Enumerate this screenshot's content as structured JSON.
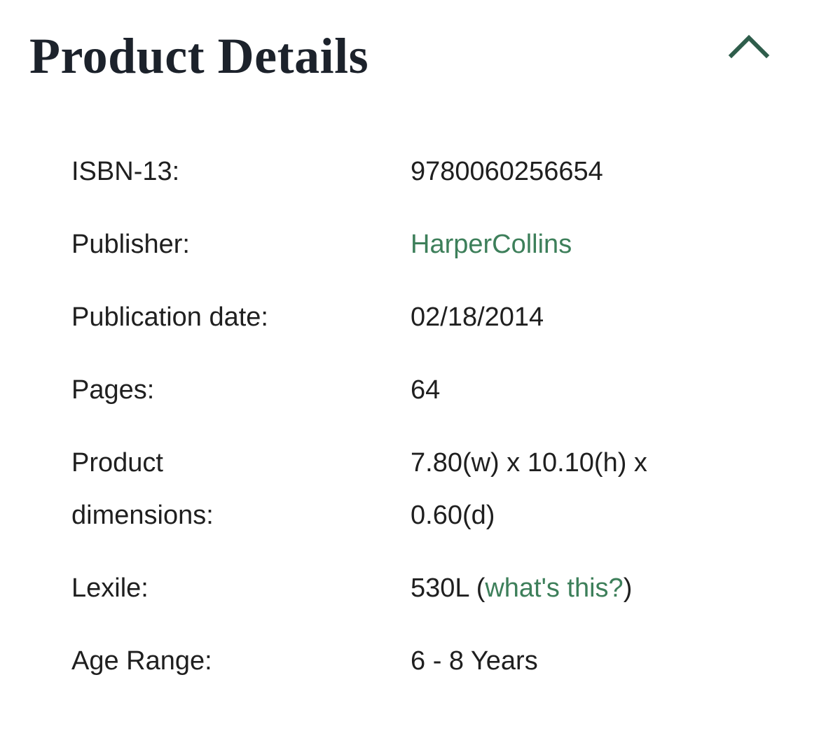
{
  "section": {
    "title": "Product Details",
    "toggle_icon": "chevron-up-icon",
    "accent_color": "#2e5d4b",
    "link_color": "#3d7f5a"
  },
  "details": {
    "isbn": {
      "label": "ISBN-13:",
      "value": "9780060256654"
    },
    "publisher": {
      "label": "Publisher:",
      "value": "HarperCollins"
    },
    "publication_date": {
      "label": "Publication date:",
      "value": "02/18/2014"
    },
    "pages": {
      "label": "Pages:",
      "value": "64"
    },
    "dimensions": {
      "label_line1": "Product",
      "label_line2": "dimensions:",
      "value_line1": "7.80(w) x 10.10(h) x",
      "value_line2": "0.60(d)"
    },
    "lexile": {
      "label": "Lexile:",
      "value": "530L",
      "open_paren": "(",
      "link": "what's this?",
      "close_paren": ")"
    },
    "age_range": {
      "label": "Age Range:",
      "value": "6 - 8 Years"
    }
  }
}
